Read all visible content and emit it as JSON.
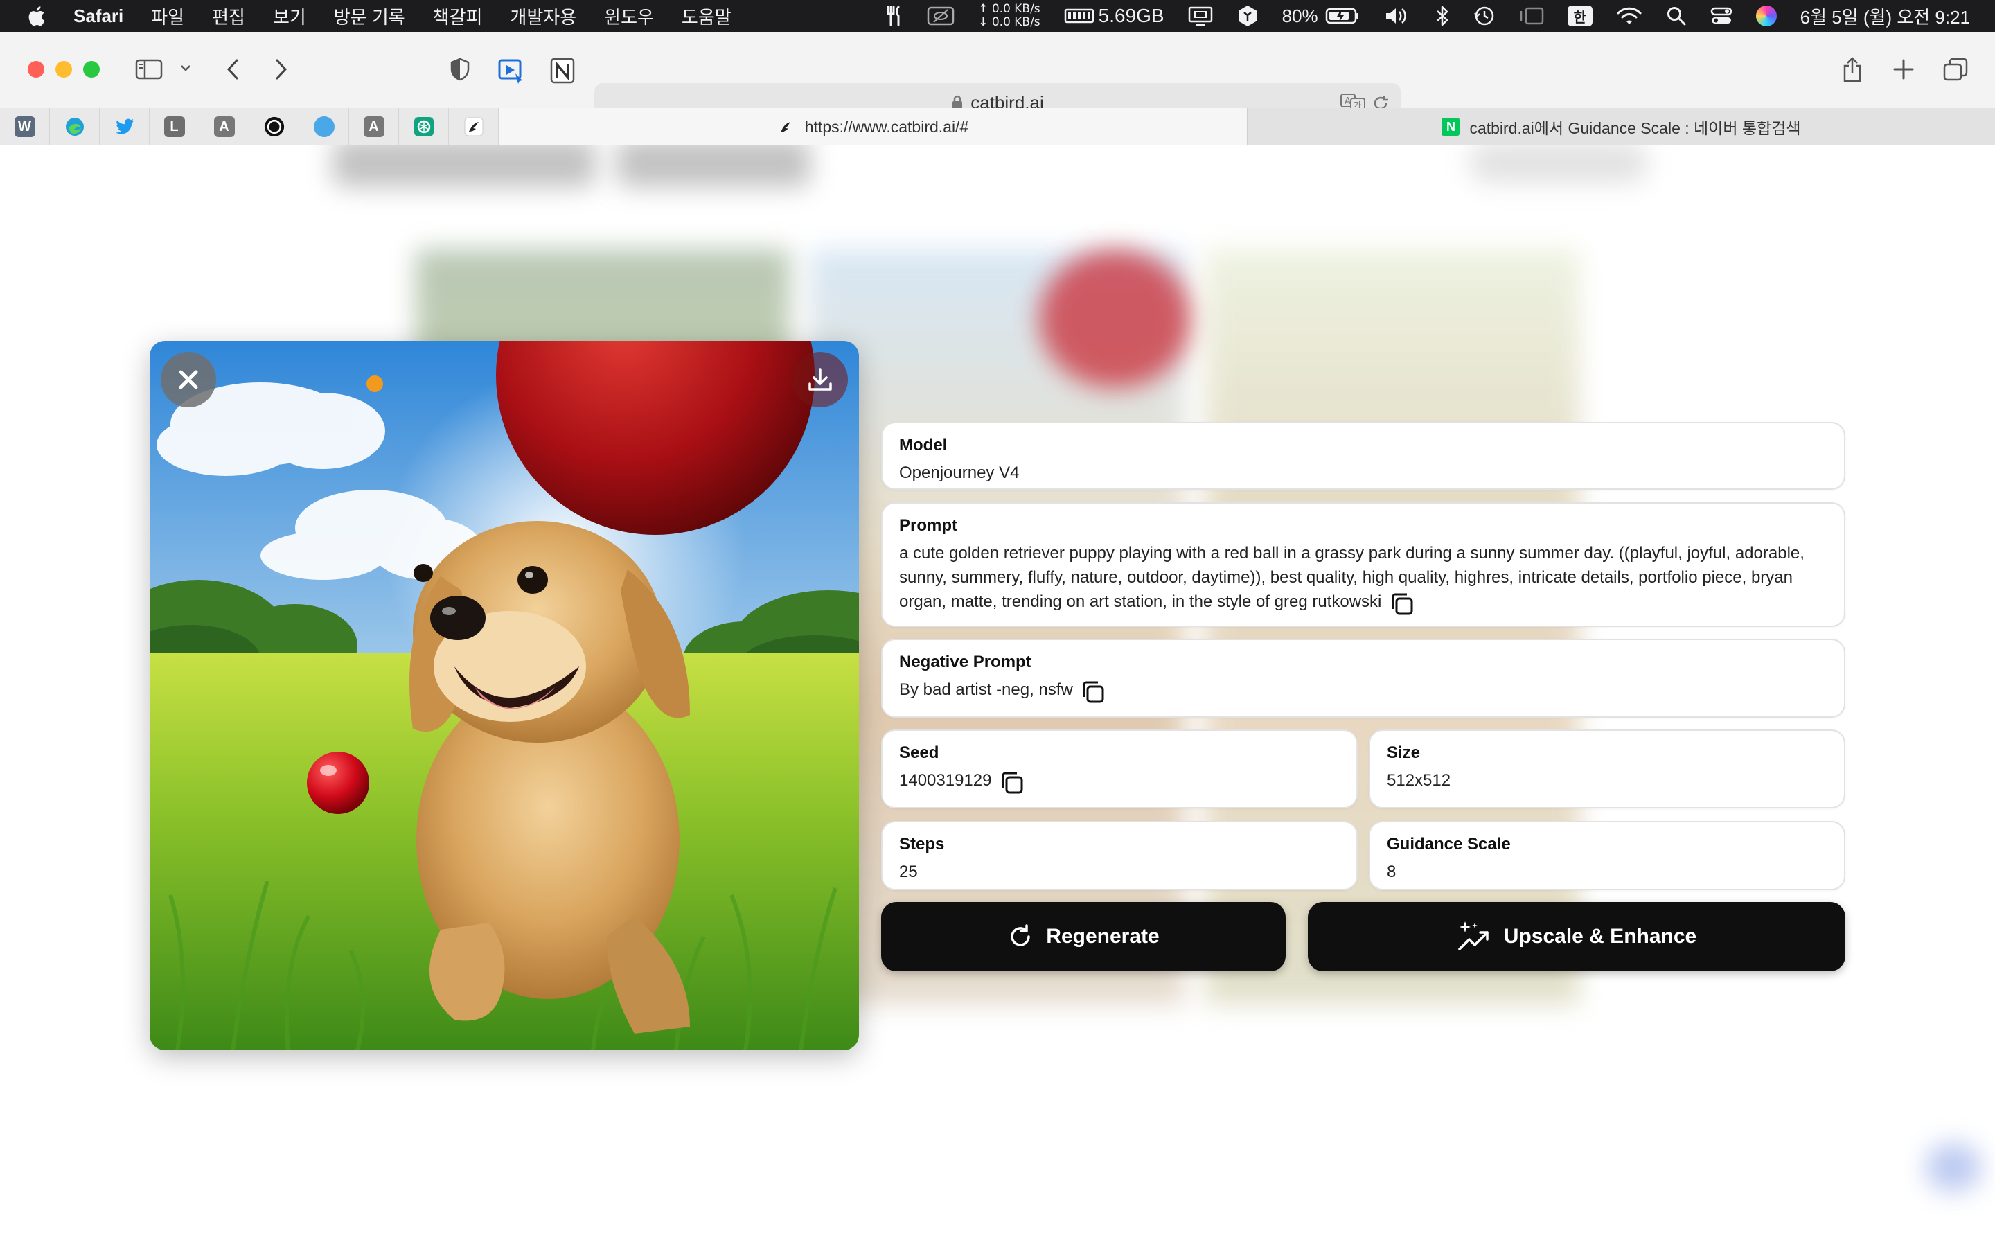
{
  "menubar": {
    "app_name": "Safari",
    "menus": [
      "파일",
      "편집",
      "보기",
      "방문 기록",
      "책갈피",
      "개발자용",
      "윈도우",
      "도움말"
    ],
    "net_up": "↑ 0.0 KB/s",
    "net_down": "↓ 0.0 KB/s",
    "memory": "5.69GB",
    "battery": "80%",
    "input_source": "한",
    "datetime": "6월 5일 (월) 오전 9:21"
  },
  "browser": {
    "address": "catbird.ai",
    "pinned_tabs": [
      {
        "icon": "w-icon",
        "letter": "W",
        "color": "#5b6b7d"
      },
      {
        "icon": "edge-icon",
        "letter": "",
        "color": "#1fa1d6"
      },
      {
        "icon": "twitter-icon",
        "letter": "",
        "color": "#1d9bf0"
      },
      {
        "icon": "l-icon",
        "letter": "L",
        "color": "#6e6e6e"
      },
      {
        "icon": "a-icon",
        "letter": "A",
        "color": "#777777"
      },
      {
        "icon": "openai-dark-icon",
        "letter": "",
        "color": "#111111"
      },
      {
        "icon": "blue-dot-icon",
        "letter": "",
        "color": "#4aa8e8"
      },
      {
        "icon": "a-icon-2",
        "letter": "A",
        "color": "#777777"
      },
      {
        "icon": "chatgpt-icon",
        "letter": "",
        "color": "#10a37f"
      },
      {
        "icon": "catbird-icon",
        "letter": "",
        "color": "#222222"
      }
    ],
    "tabs": [
      {
        "title": "https://www.catbird.ai/#",
        "active": true
      },
      {
        "title": "catbird.ai에서 Guidance Scale : 네이버 통합검색",
        "active": false
      }
    ]
  },
  "details": {
    "model": {
      "label": "Model",
      "value": "Openjourney V4"
    },
    "prompt": {
      "label": "Prompt",
      "value": "a cute golden retriever puppy playing with a red ball in a grassy park during a sunny summer day. ((playful, joyful, adorable, sunny, summery, fluffy, nature, outdoor, daytime)), best quality, high quality, highres, intricate details, portfolio piece, bryan organ, matte, trending on art station, in the style of greg rutkowski"
    },
    "negative_prompt": {
      "label": "Negative Prompt",
      "value": "By bad artist -neg, nsfw"
    },
    "seed": {
      "label": "Seed",
      "value": "1400319129"
    },
    "size": {
      "label": "Size",
      "value": "512x512"
    },
    "steps": {
      "label": "Steps",
      "value": "25"
    },
    "guidance_scale": {
      "label": "Guidance Scale",
      "value": "8"
    }
  },
  "actions": {
    "regenerate": "Regenerate",
    "upscale": "Upscale & Enhance"
  },
  "colors": {
    "button_bg": "#0f0f0f",
    "card_border": "#e2e2e2"
  }
}
